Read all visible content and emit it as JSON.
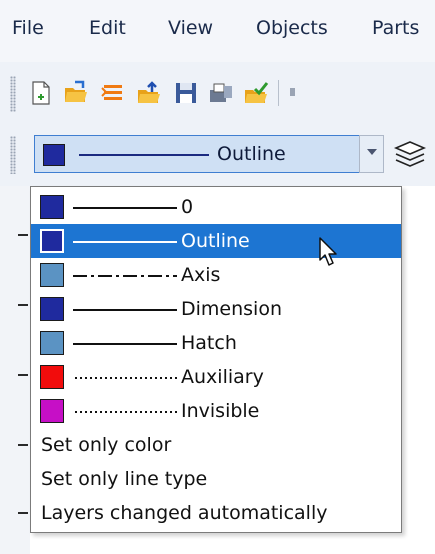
{
  "menubar": {
    "items": [
      "File",
      "Edit",
      "View",
      "Objects",
      "Parts"
    ]
  },
  "toolbar": {
    "icons": [
      "new-document-icon",
      "open-folder-icon",
      "import-icon",
      "upload-folder-icon",
      "save-icon",
      "print-icon",
      "approve-folder-icon"
    ]
  },
  "layer_combo": {
    "selected_label": "Outline",
    "selected_color": "#1f2a9e",
    "line_type": "solid"
  },
  "dropdown": {
    "layers": [
      {
        "label": "0",
        "color": "#1f2a9e",
        "line_type": "solid"
      },
      {
        "label": "Outline",
        "color": "#1f2a9e",
        "line_type": "solid",
        "selected": true
      },
      {
        "label": "Axis",
        "color": "#5b93c3",
        "line_type": "dash-dot"
      },
      {
        "label": "Dimension",
        "color": "#1f2a9e",
        "line_type": "solid"
      },
      {
        "label": "Hatch",
        "color": "#5b93c3",
        "line_type": "solid"
      },
      {
        "label": "Auxiliary",
        "color": "#f20c0c",
        "line_type": "dotted"
      },
      {
        "label": "Invisible",
        "color": "#c60fc6",
        "line_type": "dotted"
      }
    ],
    "options": [
      "Set only color",
      "Set only line type",
      "Layers changed automatically"
    ]
  }
}
